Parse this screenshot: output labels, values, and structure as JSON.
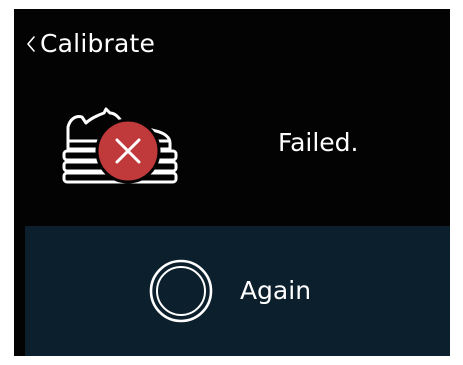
{
  "header": {
    "title": "Calibrate",
    "back_icon": "chevron-left-icon"
  },
  "status": {
    "message": "Failed.",
    "illustration_icon": "shoe-on-scale-icon",
    "badge_icon": "close-icon",
    "badge_color": "#c0393b"
  },
  "action": {
    "label": "Again",
    "icon": "ring-button-icon",
    "panel_color": "#0b1f2c"
  },
  "colors": {
    "screen_bg": "#030303",
    "text": "#ffffff"
  }
}
